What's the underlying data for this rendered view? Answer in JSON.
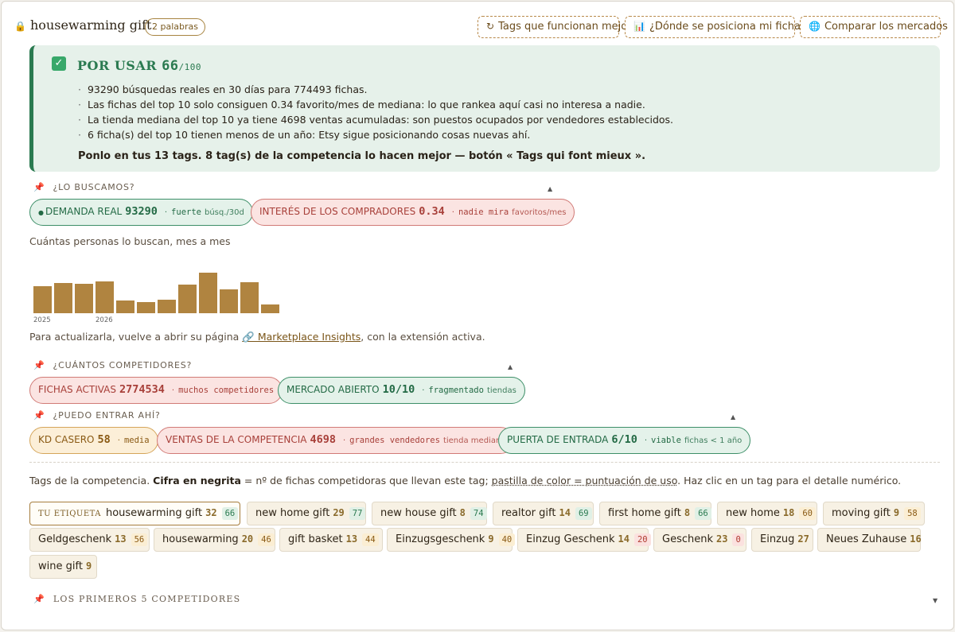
{
  "header": {
    "lock_icon": "lock-icon",
    "title": "housewarming gift",
    "words_badge": "2 palabras",
    "buttons": [
      {
        "icon": "↻",
        "label": "Tags que funcionan mejor"
      },
      {
        "icon": "📊",
        "label": "¿Dónde se posiciona mi ficha?"
      },
      {
        "icon": "🌐",
        "label": "Comparar los mercados"
      }
    ]
  },
  "verdict": {
    "title": "POR USAR",
    "score": "66",
    "max": "/100",
    "bullets": [
      "93290 búsquedas reales en 30 días para 774493 fichas.",
      "Las fichas del top 10 solo consiguen 0.34 favorito/mes de mediana: lo que rankea aquí casi no interesa a nadie.",
      "La tienda mediana del top 10 ya tiene 4698 ventas acumuladas: son puestos ocupados por vendedores establecidos.",
      "6 ficha(s) del top 10 tienen menos de un año: Etsy sigue posicionando cosas nuevas ahí."
    ],
    "footer": "Ponlo en tus 13 tags. 8 tag(s) de la competencia lo hacen mejor — botón « Tags qui font mieux »."
  },
  "sections": {
    "search": {
      "title": "¿LO BUSCAMOS?",
      "pills": [
        {
          "label": "DEMANDA REAL",
          "value": "93290",
          "desc": "fuerte",
          "sub": "búsq./30d",
          "tone": "green"
        },
        {
          "label": "INTERÉS DE LOS COMPRADORES",
          "value": "0.34",
          "desc": "nadie mira",
          "sub": "favoritos/mes",
          "tone": "red"
        }
      ],
      "chart_caption": "Cuántas personas lo buscan, mes a mes",
      "refresh_prefix": "Para actualizarla, vuelve a abrir su página ",
      "refresh_link": "🔗 Marketplace Insights",
      "refresh_suffix": ", con la extensión activa."
    },
    "competitors": {
      "title": "¿CUÁNTOS COMPETIDORES?",
      "pills": [
        {
          "label": "FICHAS ACTIVAS",
          "value": "2774534",
          "desc": "muchos competidores",
          "sub": "",
          "tone": "red"
        },
        {
          "label": "MERCADO ABIERTO",
          "value": "10/10",
          "desc": "fragmentado",
          "sub": "tiendas",
          "tone": "green"
        }
      ]
    },
    "entry": {
      "title": "¿PUEDO ENTRAR AHÍ?",
      "pills": [
        {
          "label": "KD CASERO",
          "value": "58",
          "desc": "media",
          "sub": "",
          "tone": "orange"
        },
        {
          "label": "VENTAS DE LA COMPETENCIA",
          "value": "4698",
          "desc": "grandes vendedores",
          "sub": "tienda mediana",
          "tone": "red"
        },
        {
          "label": "PUERTA DE ENTRADA",
          "value": "6/10",
          "desc": "viable",
          "sub": "fichas < 1 año",
          "tone": "green"
        }
      ]
    },
    "tags": {
      "note_start": "Tags de la competencia. ",
      "note_bold": "Cifra en negrita",
      "note_mid": " = nº de fichas competidoras que llevan este tag; ",
      "note_ul": "pastilla de color = puntuación de uso",
      "note_end": ". Haz clic en un tag para el detalle numérico.",
      "mine_label": "TU ETIQUETA",
      "chips": [
        {
          "text": "housewarming gift",
          "count": "32",
          "score": "66",
          "tone": "hi",
          "mine": true
        },
        {
          "text": "new home gift",
          "count": "29",
          "score": "77",
          "tone": "hi"
        },
        {
          "text": "new house gift",
          "count": "8",
          "score": "74",
          "tone": "hi"
        },
        {
          "text": "realtor gift",
          "count": "14",
          "score": "69",
          "tone": "hi"
        },
        {
          "text": "first home gift",
          "count": "8",
          "score": "66",
          "tone": "hi"
        },
        {
          "text": "new home",
          "count": "18",
          "score": "60",
          "tone": "mid"
        },
        {
          "text": "moving gift",
          "count": "9",
          "score": "58",
          "tone": "mid"
        },
        {
          "text": "Geldgeschenk",
          "count": "13",
          "score": "56",
          "tone": "mid"
        },
        {
          "text": "housewarming",
          "count": "20",
          "score": "46",
          "tone": "mid"
        },
        {
          "text": "gift basket",
          "count": "13",
          "score": "44",
          "tone": "mid"
        },
        {
          "text": "Einzugsgeschenk",
          "count": "9",
          "score": "40",
          "tone": "mid"
        },
        {
          "text": "Einzug Geschenk",
          "count": "14",
          "score": "20",
          "tone": "lo"
        },
        {
          "text": "Geschenk",
          "count": "23",
          "score": "0",
          "tone": "lo"
        },
        {
          "text": "Einzug",
          "count": "27",
          "score": "",
          "tone": ""
        },
        {
          "text": "Neues Zuhause",
          "count": "16",
          "score": "",
          "tone": ""
        },
        {
          "text": "wine gift",
          "count": "9",
          "score": "",
          "tone": ""
        }
      ]
    },
    "top5": {
      "title": "LOS PRIMEROS 5 COMPETIDORES"
    }
  },
  "chart_data": {
    "type": "bar",
    "title": "",
    "x_tick_labels": [
      "2025",
      "2026"
    ],
    "values": [
      35,
      39,
      38,
      41,
      17,
      15,
      18,
      37,
      53,
      31,
      40,
      11
    ],
    "ylim": [
      0,
      55
    ],
    "grid": false,
    "legend": "none"
  },
  "colors": {
    "accent": "#b08440",
    "green": "#2a7a50",
    "red": "#a8403a",
    "orange": "#8a5a14"
  }
}
